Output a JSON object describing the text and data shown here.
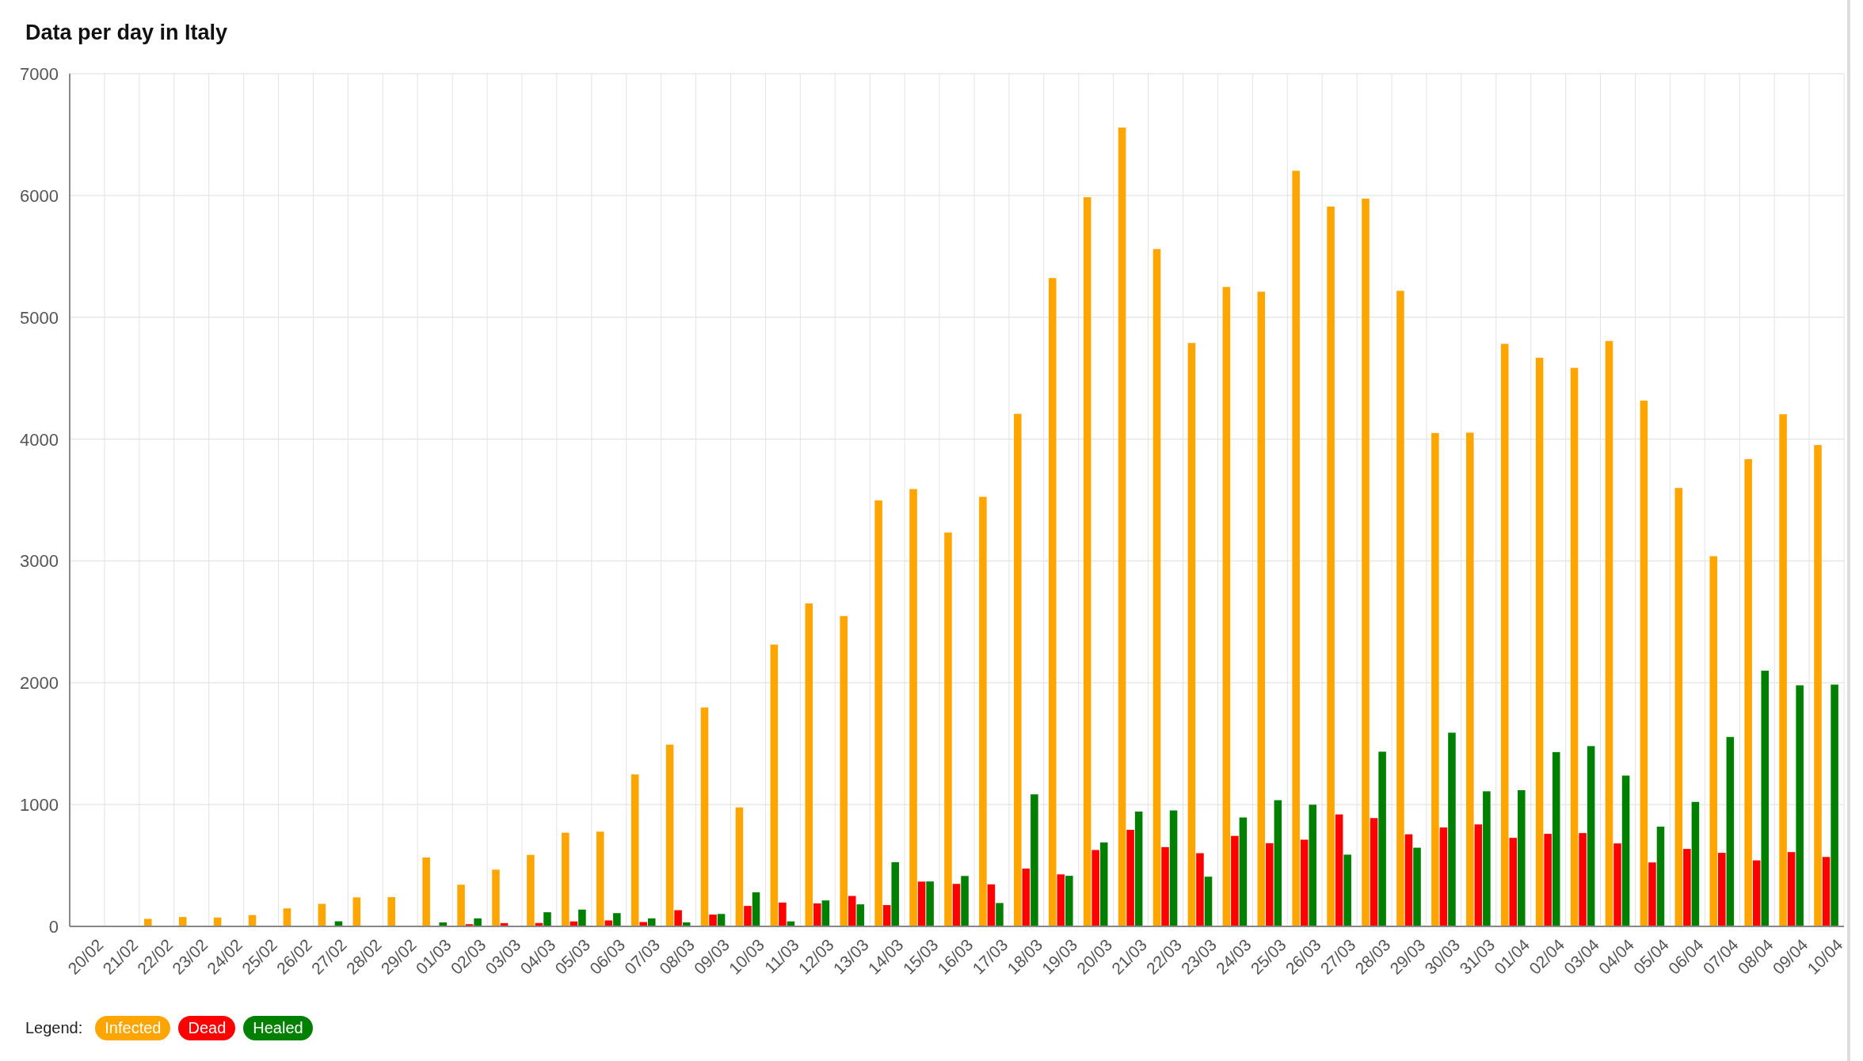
{
  "title": "Data per day in Italy",
  "chart_data": {
    "type": "bar",
    "categories": [
      "20/02",
      "21/02",
      "22/02",
      "23/02",
      "24/02",
      "25/02",
      "26/02",
      "27/02",
      "28/02",
      "29/02",
      "01/03",
      "02/03",
      "03/03",
      "04/03",
      "05/03",
      "06/03",
      "07/03",
      "08/03",
      "09/03",
      "10/03",
      "11/03",
      "12/03",
      "13/03",
      "14/03",
      "15/03",
      "16/03",
      "17/03",
      "18/03",
      "19/03",
      "20/03",
      "21/03",
      "22/03",
      "23/03",
      "24/03",
      "25/03",
      "26/03",
      "27/03",
      "28/03",
      "29/03",
      "30/03",
      "31/03",
      "01/04",
      "02/04",
      "03/04",
      "04/04",
      "05/04",
      "06/04",
      "07/04",
      "08/04",
      "09/04",
      "10/04"
    ],
    "series": [
      {
        "name": "Infected",
        "color": "#ffa500",
        "values": [
          0,
          14,
          62,
          77,
          73,
          93,
          148,
          185,
          238,
          240,
          566,
          342,
          466,
          587,
          769,
          778,
          1247,
          1492,
          1797,
          977,
          2313,
          2651,
          2547,
          3497,
          3590,
          3233,
          3526,
          4207,
          5322,
          5986,
          6557,
          5560,
          4789,
          5249,
          5210,
          6203,
          5909,
          5974,
          5217,
          4050,
          4053,
          4782,
          4668,
          4585,
          4805,
          4316,
          3599,
          3039,
          3836,
          4204,
          3951
        ]
      },
      {
        "name": "Dead",
        "color": "#ff0000",
        "values": [
          0,
          1,
          1,
          1,
          4,
          3,
          2,
          5,
          4,
          8,
          5,
          18,
          27,
          28,
          41,
          49,
          36,
          133,
          97,
          168,
          196,
          189,
          250,
          175,
          368,
          349,
          345,
          475,
          427,
          627,
          793,
          651,
          601,
          743,
          683,
          712,
          919,
          889,
          756,
          812,
          837,
          727,
          760,
          766,
          681,
          525,
          636,
          604,
          542,
          610,
          570
        ]
      },
      {
        "name": "Healed",
        "color": "#008000",
        "values": [
          0,
          0,
          0,
          0,
          1,
          0,
          0,
          42,
          1,
          0,
          33,
          66,
          11,
          116,
          138,
          109,
          66,
          33,
          102,
          280,
          41,
          213,
          181,
          527,
          369,
          414,
          192,
          1084,
          415,
          689,
          943,
          952,
          408,
          894,
          1036,
          999,
          589,
          1434,
          646,
          1590,
          1109,
          1118,
          1431,
          1480,
          1238,
          819,
          1022,
          1555,
          2099,
          1979,
          1985
        ]
      }
    ],
    "grid": true,
    "ylim": [
      0,
      7000
    ],
    "yticks": [
      0,
      1000,
      2000,
      3000,
      4000,
      5000,
      6000,
      7000
    ]
  },
  "legend": {
    "label": "Legend:"
  }
}
